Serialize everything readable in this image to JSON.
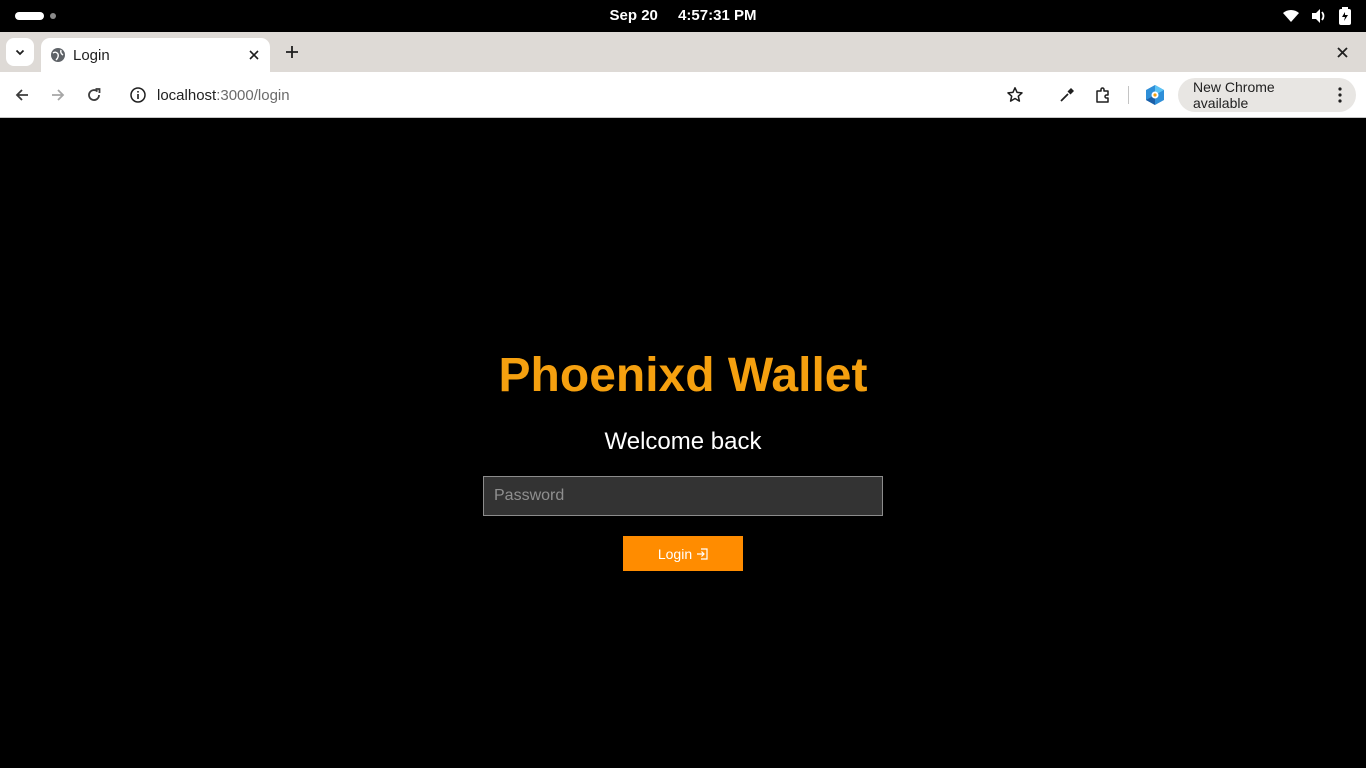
{
  "os": {
    "date": "Sep 20",
    "time": "4:57:31 PM",
    "icons": [
      "wifi-icon",
      "volume-icon",
      "battery-icon"
    ]
  },
  "browser": {
    "tab": {
      "title": "Login",
      "favicon": "globe-icon"
    },
    "url_host": "localhost",
    "url_path": ":3000/login",
    "update_chip": "New Chrome available"
  },
  "page": {
    "title": "Phoenixd Wallet",
    "subtitle": "Welcome back",
    "password_placeholder": "Password",
    "login_label": "Login"
  },
  "colors": {
    "brand": "#f5a00f",
    "button": "#ff8c00",
    "input_bg": "#333333",
    "page_bg": "#000000"
  }
}
